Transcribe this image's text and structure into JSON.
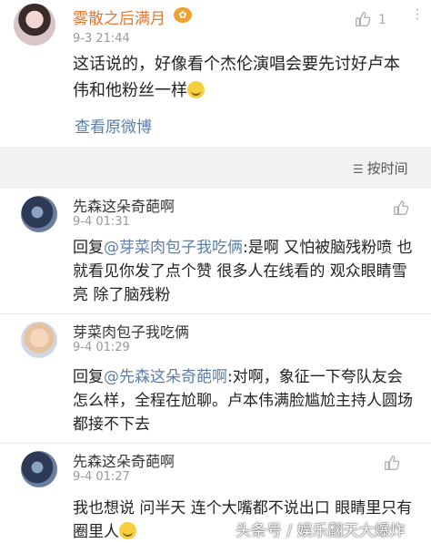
{
  "post": {
    "author": "雾散之后满月",
    "time": "9-3 21:44",
    "like_count": "1",
    "text": "这话说的，好像看个杰伦演唱会要先讨好卢本伟和他粉丝一样",
    "view_original": "查看原微博"
  },
  "sort": {
    "label": "按时间"
  },
  "comments": [
    {
      "author": "先森这朵奇葩啊",
      "time": "9-4 01:31",
      "reply_prefix": "回复",
      "mention": "@芽菜肉包子我吃俩",
      "text": ":是啊 又怕被脑残粉喷 也就看见你发了点个赞 很多人在线看的 观众眼睛雪亮 除了脑残粉"
    },
    {
      "author": "芽菜肉包子我吃俩",
      "time": "9-4 01:29",
      "reply_prefix": "回复",
      "mention": "@先森这朵奇葩啊",
      "text": ":对啊，象征一下夸队友会怎么样，全程在尬聊。卢本伟满脸尴尬主持人圆场都接不下去"
    },
    {
      "author": "先森这朵奇葩啊",
      "time": "9-4 01:27",
      "text": "我也想说 问半天  连个大嘴都不说出口  眼睛里只有圈里人"
    }
  ],
  "watermark": "头条号 / 娱乐翻天大爆炸",
  "icons": {
    "like": "thumbs-up-icon",
    "more": "more-icon",
    "sort": "sort-icon",
    "emoji": "smile-emoji-icon",
    "vip": "vip-badge-icon"
  },
  "colors": {
    "link": "#5a7ea8",
    "author_highlight": "#e3782e",
    "background": "#f2f2f2"
  }
}
